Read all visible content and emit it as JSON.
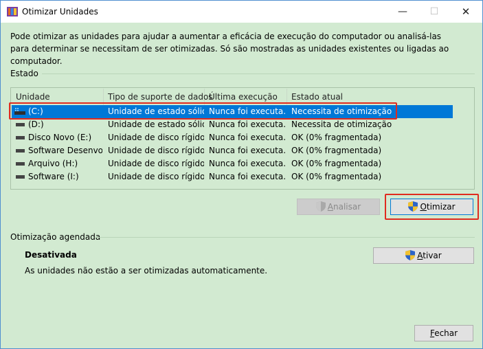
{
  "window": {
    "title": "Otimizar Unidades",
    "min_glyph": "—",
    "max_glyph": "☐",
    "close_glyph": "✕"
  },
  "description": "Pode otimizar as unidades para ajudar a aumentar a eficácia de execução do computador ou analisá-las para determinar se necessitam de ser otimizadas. Só são mostradas as unidades existentes ou ligadas ao computador.",
  "status": {
    "label": "Estado",
    "columns": [
      "Unidade",
      "Tipo de suporte de dados",
      "Última execução",
      "Estado atual"
    ],
    "drives": [
      {
        "name": "(C:)",
        "media": "Unidade de estado sólido",
        "last_run": "Nunca foi executa...",
        "state": "Necessita de otimização",
        "icon": "ssd-drive-icon",
        "selected": true
      },
      {
        "name": "(D:)",
        "media": "Unidade de estado sólido",
        "last_run": "Nunca foi executa...",
        "state": "Necessita de otimização",
        "icon": "drive-icon",
        "selected": false
      },
      {
        "name": "Disco Novo (E:)",
        "media": "Unidade de disco rígido",
        "last_run": "Nunca foi executa...",
        "state": "OK (0% fragmentada)",
        "icon": "drive-icon",
        "selected": false
      },
      {
        "name": "Software Desenvol...",
        "media": "Unidade de disco rígido",
        "last_run": "Nunca foi executa...",
        "state": "OK (0% fragmentada)",
        "icon": "drive-icon",
        "selected": false
      },
      {
        "name": "Arquivo (H:)",
        "media": "Unidade de disco rígido",
        "last_run": "Nunca foi executa...",
        "state": "OK (0% fragmentada)",
        "icon": "drive-icon",
        "selected": false
      },
      {
        "name": "Software (I:)",
        "media": "Unidade de disco rígido",
        "last_run": "Nunca foi executa...",
        "state": "OK (0% fragmentada)",
        "icon": "drive-icon",
        "selected": false
      }
    ]
  },
  "actions": {
    "analyze_label": "Analisar",
    "analyze_mnemonic": "A",
    "analyze_rest": "nalisar",
    "optimize_label": "Otimizar",
    "optimize_mnemonic": "O",
    "optimize_rest": "timizar"
  },
  "scheduled": {
    "label": "Otimização agendada",
    "status": "Desativada",
    "detail": "As unidades não estão a ser otimizadas automaticamente.",
    "activate_label": "Ativar",
    "activate_mnemonic": "A",
    "activate_rest": "tivar"
  },
  "footer": {
    "close_label": "Fechar",
    "close_mnemonic": "F",
    "close_rest": "echar"
  },
  "colors": {
    "background": "#d2ead1",
    "selection": "#0078d7",
    "highlight": "#e02b1f",
    "window_border": "#4f8fd0"
  }
}
